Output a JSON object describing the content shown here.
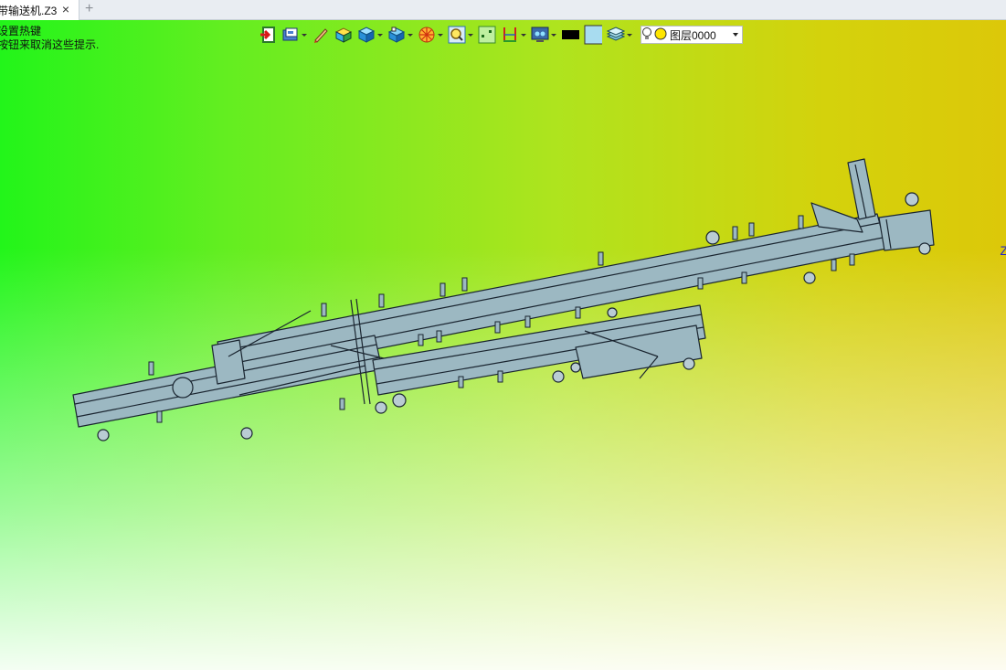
{
  "tab": {
    "title": "带输送机.Z3",
    "close": "×",
    "add": "+"
  },
  "hint": {
    "line1": "设置热键",
    "line2": "按钮来取消这些提示."
  },
  "axis_label": "Z",
  "layer": {
    "selected": "图层0000"
  },
  "toolbar_icons": [
    "exit-icon",
    "view-icon",
    "pen-icon",
    "box-yellow-icon",
    "cube-blue-icon",
    "cube-rotate-icon",
    "wheel-icon",
    "zoom-icon",
    "frame-icon",
    "dimension-icon",
    "display-icon",
    "color-black-swatch",
    "color-lightblue-swatch",
    "layers-icon",
    "bulb-icon",
    "layer-color-icon"
  ],
  "colors": {
    "model_fill": "#9cb8c2",
    "model_stroke": "#1a2530",
    "black_swatch": "#000000",
    "blue_swatch": "#a8dcf0"
  }
}
